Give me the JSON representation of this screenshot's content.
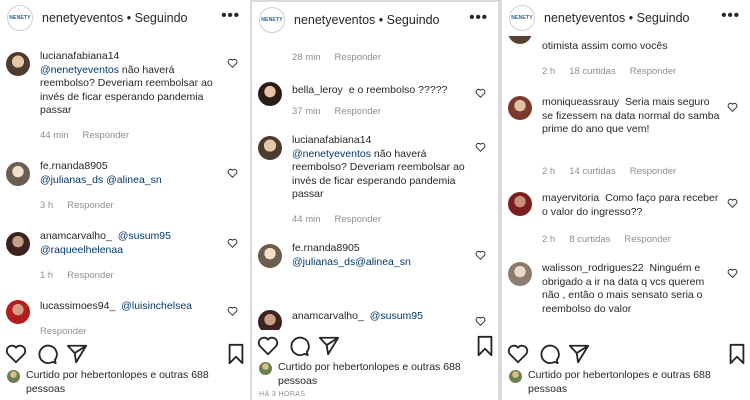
{
  "header": {
    "account": "nenetyeventos",
    "separator": " • ",
    "follow_status": "Seguindo",
    "logo_text": "NENETY"
  },
  "common": {
    "reply_label": "Responder"
  },
  "panels": [
    {
      "comments": [
        {
          "user": "lucianafabiana14",
          "mention": "@nenetyeventos",
          "text": " não haverá reembolso? Deveriam reembolsar ao invés de ficar esperando pandemia passar",
          "time": "44 min",
          "likes": ""
        },
        {
          "user": "fe.rnanda8905",
          "mention": "@julianas_ds",
          "text": "@alinea_sn",
          "time": "3 h",
          "likes": ""
        },
        {
          "user": "anamcarvalho_",
          "mention": "@susum95",
          "text": "@raqueelhelenaa",
          "time": "1 h",
          "likes": ""
        },
        {
          "user": "lucassimoes94_",
          "mention": "@luisinchelsea",
          "text": "",
          "time": "",
          "likes": ""
        }
      ],
      "liked_by": {
        "prefix": "Curtido por ",
        "user": "hebertonlopes",
        "suffix": " e outras 688 pessoas"
      },
      "timestamp": ""
    },
    {
      "comments": [
        {
          "user": "",
          "mention": "",
          "text": "",
          "time": "28 min",
          "likes": ""
        },
        {
          "user": "bella_leroy",
          "mention": "",
          "text": "e o reembolso ?????",
          "time": "37 min",
          "likes": ""
        },
        {
          "user": "lucianafabiana14",
          "mention": "@nenetyeventos",
          "text": " não haverá reembolso? Deveriam reembolsar ao invés de ficar esperando pandemia passar",
          "time": "44 min",
          "likes": ""
        },
        {
          "user": "fe.rnanda8905",
          "mention": "@julianas_ds",
          "text": "@alinea_sn",
          "time": "",
          "likes": ""
        },
        {
          "user": "anamcarvalho_",
          "mention": "@susum95",
          "text": "",
          "time": "",
          "likes": ""
        }
      ],
      "liked_by": {
        "prefix": "Curtido por ",
        "user": "hebertonlopes",
        "suffix": " e outras 688 pessoas"
      },
      "timestamp": "HÁ 3 HORAS"
    },
    {
      "comments": [
        {
          "user": "",
          "mention": "",
          "text": "otimista assim como vocês",
          "time": "2 h",
          "likes": "18 curtidas"
        },
        {
          "user": "moniqueassrauy",
          "mention": "",
          "text": "Seria mais seguro se fizessem na data normal do samba prime do ano que vem!",
          "time": "2 h",
          "likes": "14 curtidas"
        },
        {
          "user": "mayervitoria",
          "mention": "",
          "text": "Como faço para receber o valor do ingresso??",
          "time": "2 h",
          "likes": "8 curtidas"
        },
        {
          "user": "walisson_rodrigues22",
          "mention": "",
          "text": "Ninguém e obrigado a ir na data q vcs querem não , então o mais sensato seria o reembolso do valor",
          "time": "",
          "likes": ""
        }
      ],
      "liked_by": {
        "prefix": "Curtido por ",
        "user": "hebertonlopes",
        "suffix": " e outras 688 pessoas"
      },
      "timestamp": ""
    }
  ]
}
